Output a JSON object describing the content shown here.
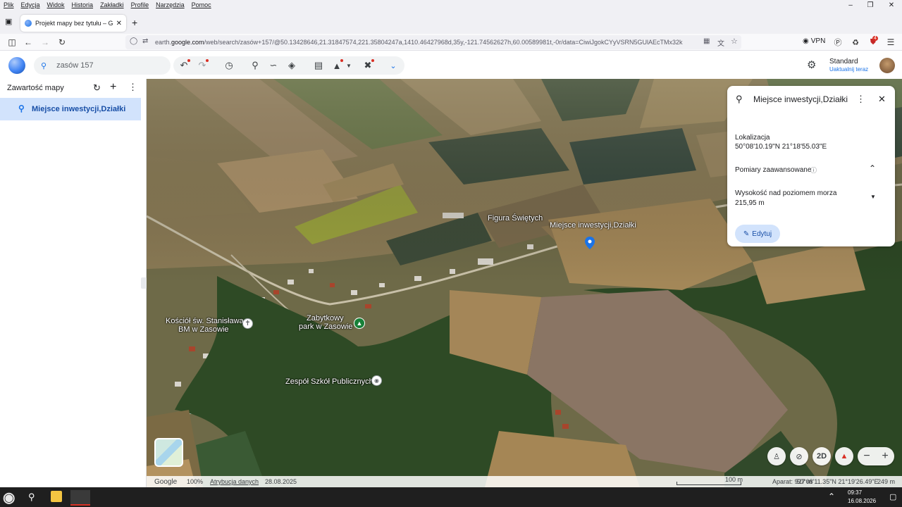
{
  "menubar": {
    "items": [
      "Plik",
      "Edycja",
      "Widok",
      "Historia",
      "Zakładki",
      "Profile",
      "Narzędzia",
      "Pomoc"
    ],
    "minimize_icon": "minimize-icon",
    "restore_icon": "restore-icon",
    "close_icon": "close-icon"
  },
  "tab": {
    "title": "Projekt mapy bez tytułu – Goog"
  },
  "address": {
    "url_prefix": "earth.",
    "url_domain": "google.com",
    "url_rest": "/web/search/zasów+157/@50.13428646,21.31847574,221.35804247a,1410.46427968d,35y,-121.74562627h,60.00589981t,-0r/data=CiwiJgokCYyVSRN5GUlAEcTMx32k",
    "vpn_label": "VPN",
    "extension_badge": "4"
  },
  "earth": {
    "search_value": "zasów 157",
    "account_plan": "Standard",
    "account_action": "Uaktualnij teraz"
  },
  "left_panel": {
    "title": "Zawartość mapy",
    "items": [
      {
        "label": "Miejsce inwestycji,Działki"
      }
    ]
  },
  "map_labels": {
    "pin": "Miejsce inwestycji,Działki",
    "figura": "Figura Świętych",
    "kosciol_line1": "Kościół św. Stanisława",
    "kosciol_line2": "BM w Zasowie",
    "park_line1": "Zabytkowy",
    "park_line2": "park w Zasowie",
    "szkola": "Zespół Szkół Publicznych"
  },
  "info_card": {
    "title": "Miejsce inwestycji,Działki",
    "location_label": "Lokalizacja",
    "location_value": "50°08'10.19\"N 21°18'55.03\"E",
    "advanced_label": "Pomiary zaawansowane",
    "elevation_label": "Wysokość nad poziomem morza",
    "elevation_value": "215,95 m",
    "edit_label": "Edytuj"
  },
  "bottom_bar": {
    "google": "Google",
    "zoom": "100%",
    "attribution": "Atrybucja danych",
    "date": "28.08.2025",
    "scale": "100 m",
    "camera": "Aparat: 927 m",
    "coords": "50°08'11.35\"N 21°19'26.49\"E",
    "elevation": "249 m"
  },
  "map_controls": {
    "mode_2d": "2D"
  },
  "taskbar": {
    "time": "09:37",
    "date": "16.08.2026"
  },
  "colors": {
    "accent": "#1a73e8",
    "selected_bg": "#d2e3fc",
    "pin": "#1a73e8"
  }
}
